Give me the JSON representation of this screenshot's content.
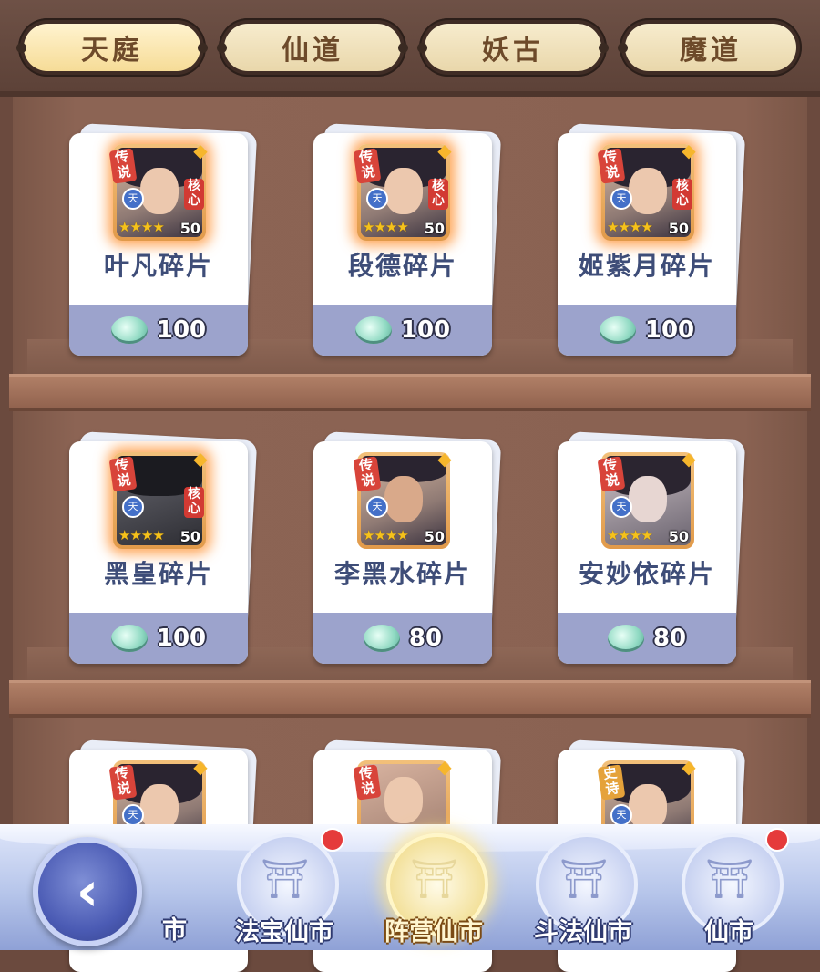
{
  "tabs": [
    {
      "label": "天庭",
      "active": true
    },
    {
      "label": "仙道",
      "active": false
    },
    {
      "label": "妖古",
      "active": false
    },
    {
      "label": "魔道",
      "active": false
    }
  ],
  "cards": [
    {
      "name": "叶凡碎片",
      "price": "100",
      "rank": "传说",
      "core": "核心",
      "faction": "天",
      "level": "50",
      "stars": 4
    },
    {
      "name": "段德碎片",
      "price": "100",
      "rank": "传说",
      "core": "核心",
      "faction": "天",
      "level": "50",
      "stars": 4
    },
    {
      "name": "姬紫月碎片",
      "price": "100",
      "rank": "传说",
      "core": "核心",
      "faction": "天",
      "level": "50",
      "stars": 4
    },
    {
      "name": "黑皇碎片",
      "price": "100",
      "rank": "传说",
      "core": "核心",
      "faction": "天",
      "level": "50",
      "stars": 4
    },
    {
      "name": "李黑水碎片",
      "price": "80",
      "rank": "传说",
      "faction": "天",
      "level": "50",
      "stars": 4
    },
    {
      "name": "安妙依碎片",
      "price": "80",
      "rank": "传说",
      "faction": "天",
      "level": "50",
      "stars": 4
    },
    {
      "rank": "传说",
      "faction": "天"
    },
    {
      "rank": "传说"
    },
    {
      "rank": "史诗",
      "faction": "天"
    }
  ],
  "nav": {
    "back_icon": "back-arrow-icon",
    "partial_label": "市",
    "items": [
      {
        "label": "法宝仙市",
        "badge": true
      },
      {
        "label": "阵营仙市",
        "active": true
      },
      {
        "label": "斗法仙市"
      },
      {
        "label": "仙市",
        "badge": true
      }
    ]
  },
  "colors": {
    "legend_glow": "#ff8c28",
    "accent_text": "#3e4d78",
    "badge": "#e53b3b"
  }
}
